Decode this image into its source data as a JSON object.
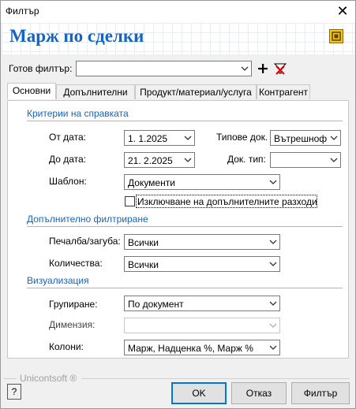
{
  "window": {
    "title": "Филтър",
    "close_glyph": "✕"
  },
  "header": {
    "heading": "Марж по сделки",
    "logo_icon": "report-logo-icon"
  },
  "filter": {
    "label": "Готов филтър:",
    "value": ""
  },
  "tabs": [
    {
      "label": "Основни",
      "active": true
    },
    {
      "label": "Допълнителни",
      "active": false
    },
    {
      "label": "Продукт/материал/услуга",
      "active": false
    },
    {
      "label": "Контрагент",
      "active": false
    }
  ],
  "criteria": {
    "section": "Критерии на справката",
    "from_date": {
      "label": "От дата:",
      "value": "1.  1.2025"
    },
    "to_date": {
      "label": "До дата:",
      "value": "21.  2.2025"
    },
    "doc_types": {
      "label": "Типове док.",
      "value": "Вътрешноф"
    },
    "doc_type": {
      "label": "Док. тип:",
      "value": ""
    },
    "template": {
      "label": "Шаблон:",
      "value": "Документи"
    },
    "exclude_checkbox": {
      "label": "Изключване на допълнителните разходи",
      "checked": false
    }
  },
  "additional": {
    "section": "Допълнително филтриране",
    "profit_loss": {
      "label": "Печалба/загуба:",
      "value": "Всички"
    },
    "quantity": {
      "label": "Количества:",
      "value": "Всички"
    }
  },
  "visualization": {
    "section": "Визуализация",
    "grouping": {
      "label": "Групиране:",
      "value": "По документ"
    },
    "dimension": {
      "label": "Димензия:",
      "value": ""
    },
    "columns": {
      "label": "Колони:",
      "value": "Марж, Надценка %, Марж %"
    }
  },
  "footer": {
    "brand": "Unicontsoft ®",
    "help_glyph": "?",
    "ok": "OK",
    "cancel": "Отказ",
    "filter": "Филтър"
  },
  "colors": {
    "accent": "#1464c8",
    "section_line": "#9fb8d8",
    "default_button_border": "#0078d7"
  }
}
